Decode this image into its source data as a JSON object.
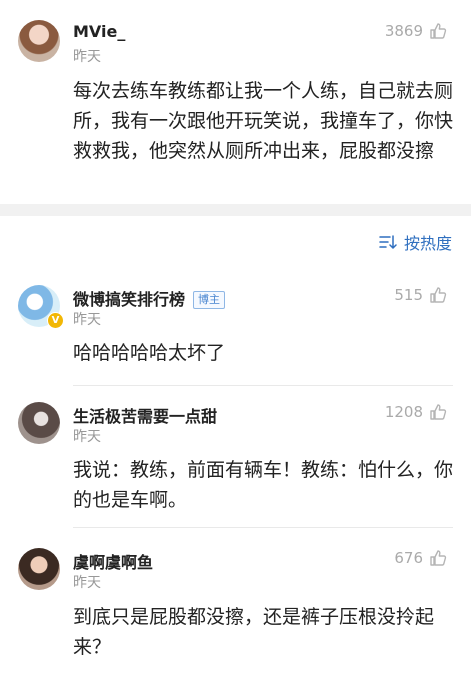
{
  "top_comment": {
    "username": "MVie_",
    "time": "昨天",
    "likes": "3869",
    "text": "每次去练车教练都让我一个人练，自己就去厕所，我有一次跟他开玩笑说，我撞车了，你快救救我，他突然从厕所冲出来，屁股都没擦"
  },
  "sort": {
    "label": "按热度",
    "icon": "sort-icon"
  },
  "replies": [
    {
      "username": "微博搞笑排行榜",
      "badge": "博主",
      "verified": "V",
      "time": "昨天",
      "likes": "515",
      "text": "哈哈哈哈哈太坏了"
    },
    {
      "username": "生活极苦需要一点甜",
      "time": "昨天",
      "likes": "1208",
      "text": "我说：教练，前面有辆车！教练：怕什么，你的也是车啊。"
    },
    {
      "username": "虞啊虞啊鱼",
      "time": "昨天",
      "likes": "676",
      "text": "到底只是屁股都没擦，还是裤子压根没拎起来？"
    }
  ],
  "colors": {
    "link": "#2f6fbf",
    "muted": "#999999",
    "badge_border": "#8fb7e5",
    "verified": "#f2b705"
  }
}
